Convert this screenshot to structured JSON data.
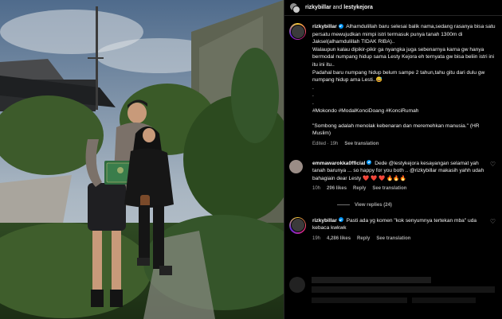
{
  "header": {
    "user1": "rizkybillar",
    "and_text": "and",
    "user2": "lestykejora"
  },
  "caption": {
    "username": "rizkybillar",
    "line1": "Alhamdulillah baru selesai balik nama,sedang rasanya bisa satu persatu mewujudkan mimpi istri termasuk punya tanah 1300m di Jaksel(alhamdulillah TIDAK RIBA)..",
    "line2": "Walaupun kalau dipikir-pikir ga nyangka juga sebenarnya karna gw hanya bermodal numpang hidup sama Lesty Kejora eh ternyata gw bisa beliin istri ini itu ini itu..",
    "line3": "Padahal baru numpang hidup belum sampe 2 tahun,tahu gitu dari dulu gw numpang hidup ama Lesti..😅",
    "dot1": ".",
    "dot2": ".",
    "dot3": ".",
    "hashtags": "#Mokondo #ModalKonciDoang #KonciRumah",
    "quote": "\"Sombong adalah menolak kebenaran dan meremehkan manusia.\" (HR Muslim)",
    "edited": "Edited · 19h",
    "see_translation": "See translation"
  },
  "comments": [
    {
      "username": "emmawarokka0fficial",
      "text": "Dede @lestykejora kesayangan selamat yah tanah barunya ... so happy for you both .. @rizkybillar makasih yahh udah bahagiain dear Lesty ❤️ ❤️ ❤️ 🔥🔥🔥",
      "time": "10h",
      "likes": "296 likes",
      "reply": "Reply",
      "see_translation": "See translation",
      "view_replies": "View replies (24)"
    },
    {
      "username": "rizkybillar",
      "text": "Pasti ada yg komen \"kok senyumnya tertekan mba\" uda kebaca kwkwk",
      "time": "19h",
      "likes": "4,286 likes",
      "reply": "Reply",
      "see_translation": "See translation"
    }
  ],
  "icons": {
    "like": "heart-icon",
    "verified": "verified-badge-icon"
  },
  "colors": {
    "background": "#000000",
    "verified": "#0095f6",
    "muted": "#a8a8a8"
  }
}
